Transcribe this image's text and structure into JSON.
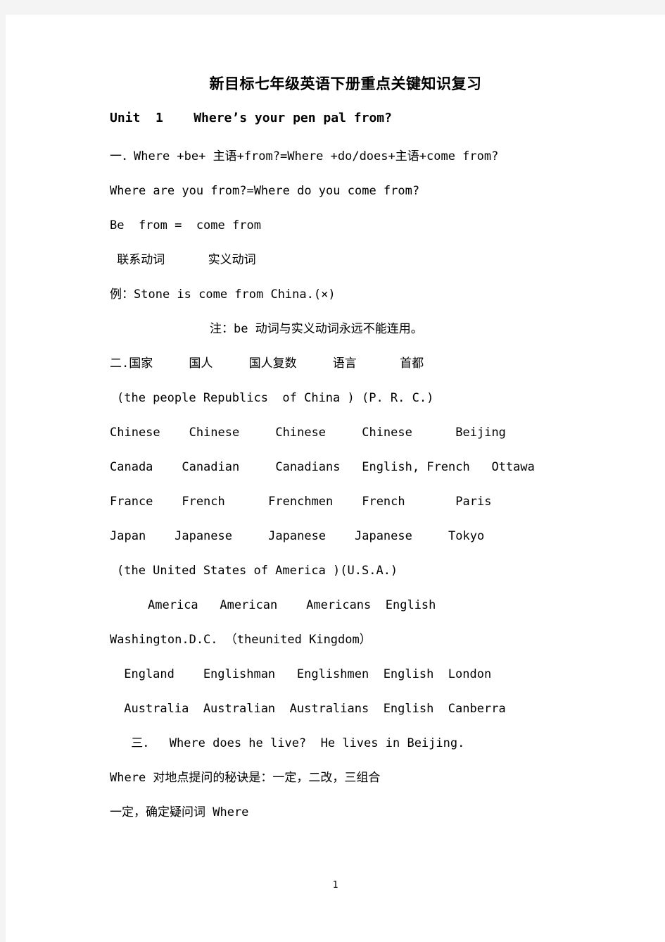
{
  "document": {
    "title": "新目标七年级英语下册重点关键知识复习",
    "unit_heading": "Unit  1    Where’s your pen pal from?",
    "page_number": "1",
    "body_lines": [
      {
        "text": "一．Where +be+ 主语+from?=Where +do/does+主语+come from?",
        "indent": "none"
      },
      {
        "text": "Where are you from?=Where do you come from?",
        "indent": "none"
      },
      {
        "text": "Be  from =  come from",
        "indent": "none"
      },
      {
        "text": " 联系动词      实义动词",
        "indent": "none"
      },
      {
        "text": "例：Stone is come from China.(×)",
        "indent": "none"
      },
      {
        "text": "注：be 动词与实义动词永远不能连用。",
        "indent": "note"
      },
      {
        "text": "二.国家     国人     国人复数     语言      首都",
        "indent": "none"
      },
      {
        "text": "(the people Republics  of China ) (P. R. C.)",
        "indent": "indent-1"
      },
      {
        "text": "Chinese    Chinese     Chinese     Chinese      Beijing",
        "indent": "none"
      },
      {
        "text": "Canada    Canadian     Canadians   English, French   Ottawa",
        "indent": "none"
      },
      {
        "text": "France    French      Frenchmen    French       Paris",
        "indent": "none"
      },
      {
        "text": "Japan    Japanese     Japanese    Japanese     Tokyo",
        "indent": "none"
      },
      {
        "text": "(the United States of America )(U.S.A.)",
        "indent": "indent-1"
      },
      {
        "text": "America   American    Americans  English",
        "indent": "america"
      },
      {
        "text": "Washington.D.C. （theunited Kingdom）",
        "indent": "none"
      },
      {
        "text": " England    Englishman   Englishmen  English  London",
        "indent": "indent-1"
      },
      {
        "text": " Australia  Australian  Australians  English  Canberra",
        "indent": "indent-1"
      },
      {
        "text": " 三．  Where does he live?  He lives in Beijing.",
        "indent": "indent-2"
      },
      {
        "text": "Where 对地点提问的秘诀是：一定，二改，三组合",
        "indent": "none"
      },
      {
        "text": "一定，确定疑问词 Where",
        "indent": "none"
      }
    ]
  }
}
